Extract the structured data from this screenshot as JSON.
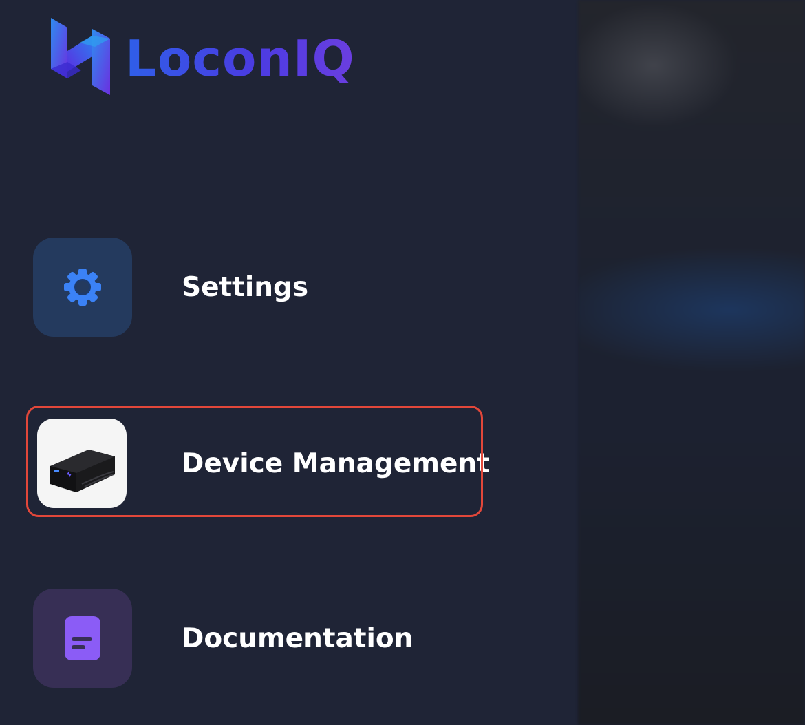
{
  "brand": {
    "name": "LoconIQ",
    "logo_icon": "loconiq-logo-icon",
    "gradient_colors": [
      "#2f5fe8",
      "#6b3ee0"
    ]
  },
  "menu": {
    "items": [
      {
        "label": "Settings",
        "icon": "gear-icon",
        "icon_color": "#3b82f6",
        "tile_color": "#243a5e"
      },
      {
        "label": "Device Management",
        "icon": "gps-tracker-device-icon",
        "tile_color": "#f5f5f5",
        "highlighted": true
      },
      {
        "label": "Documentation",
        "icon": "document-icon",
        "icon_color": "#8b5cf6",
        "tile_color": "#372f55"
      }
    ]
  },
  "highlight_color": "#e2473a"
}
